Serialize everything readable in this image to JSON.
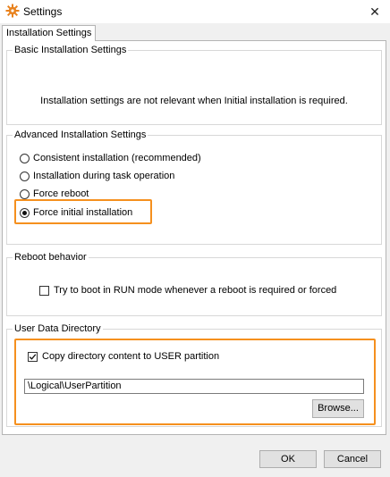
{
  "window": {
    "title": "Settings",
    "close_glyph": "✕"
  },
  "tabs": [
    {
      "label": "Installation Settings"
    }
  ],
  "basic": {
    "legend": "Basic Installation Settings",
    "message": "Installation settings are not relevant when Initial installation is required."
  },
  "advanced": {
    "legend": "Advanced Installation Settings",
    "options": [
      {
        "label": "Consistent installation (recommended)",
        "selected": false
      },
      {
        "label": "Installation during task operation",
        "selected": false
      },
      {
        "label": "Force reboot",
        "selected": false
      },
      {
        "label": "Force initial installation",
        "selected": true
      }
    ]
  },
  "reboot": {
    "legend": "Reboot behavior",
    "checkbox_label": "Try to boot in RUN mode whenever a reboot is required or forced",
    "checked": false
  },
  "user_data": {
    "legend": "User Data Directory",
    "checkbox_label": "Copy directory content to USER partition",
    "checked": true,
    "path_value": "\\Logical\\UserPartition",
    "browse_label": "Browse..."
  },
  "footer": {
    "ok_label": "OK",
    "cancel_label": "Cancel"
  },
  "colors": {
    "highlight": "#f5901e",
    "icon": "#e8821e"
  },
  "icons": {
    "app": "gear-icon",
    "close": "close-icon"
  }
}
